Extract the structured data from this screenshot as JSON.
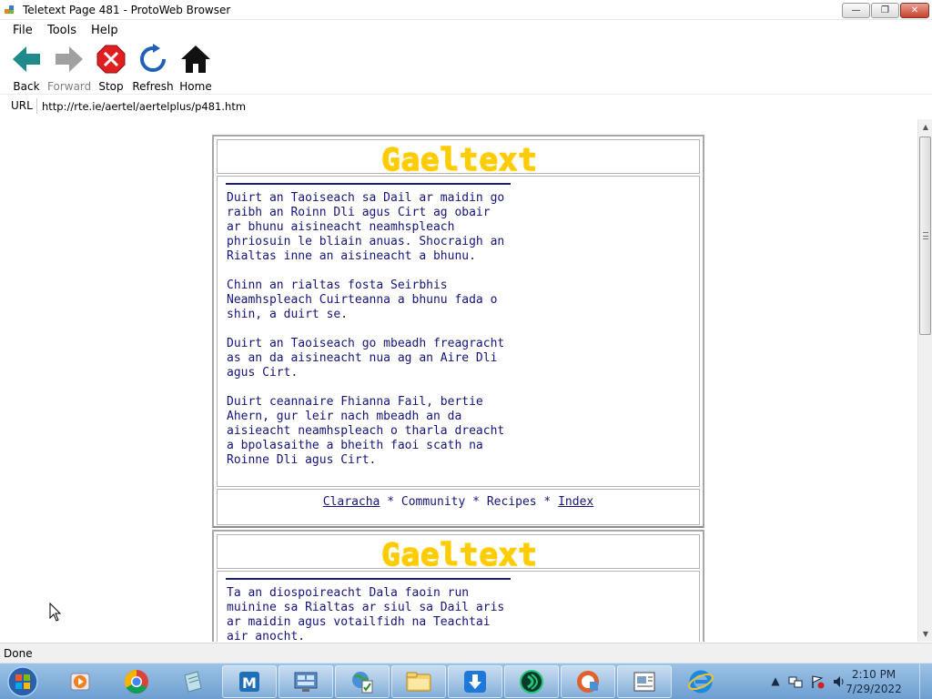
{
  "window": {
    "title": "Teletext Page 481 - ProtoWeb Browser",
    "controls": {
      "minimize": "—",
      "maximize": "❐",
      "close": "✕"
    }
  },
  "menu": {
    "file": "File",
    "tools": "Tools",
    "help": "Help"
  },
  "toolbar": {
    "back": "Back",
    "forward": "Forward",
    "stop": "Stop",
    "refresh": "Refresh",
    "home": "Home"
  },
  "address": {
    "label": "URL",
    "value": "http://rte.ie/aertel/aertelplus/p481.htm"
  },
  "teletext": {
    "logo_text": "Gaeltext",
    "logo_color": "#ffcc00",
    "text_color": "#14147a",
    "page1_text": "Duirt an Taoiseach sa Dail ar maidin go\nraibh an Roinn Dli agus Cirt ag obair\nar bhunu aisineacht neamhspleach\nphriosuin le bliain anuas. Shocraigh an\nRialtas inne an aisineacht a bhunu.\n\nChinn an rialtas fosta Seirbhis\nNeamhspleach Cuirteanna a bhunu fada o\nshin, a duirt se.\n\nDuirt an Taoiseach go mbeadh freagracht\nas an da aisineacht nua ag an Aire Dli\nagus Cirt.\n\nDuirt ceannaire Fhianna Fail, bertie\nAhern, gur leir nach mbeadh an da\naisieacht neamhspleach o tharla dreacht\na bpolasaithe a bheith faoi scath na\nRoinne Dli agus Cirt.",
    "page2_text": "Ta an diospoireacht Dala faoin run\nmuinine sa Rialtas ar siul sa Dail aris\nar maidin agus votailfidh na Teachtai\nair anocht.",
    "nav": {
      "claracha": "Claracha",
      "sep": " * ",
      "community": "Community",
      "recipes": "Recipes",
      "index": "Index"
    }
  },
  "status": {
    "text": "Done"
  },
  "taskbar": {
    "clock_time": "2:10 PM",
    "clock_date": "7/29/2022"
  }
}
